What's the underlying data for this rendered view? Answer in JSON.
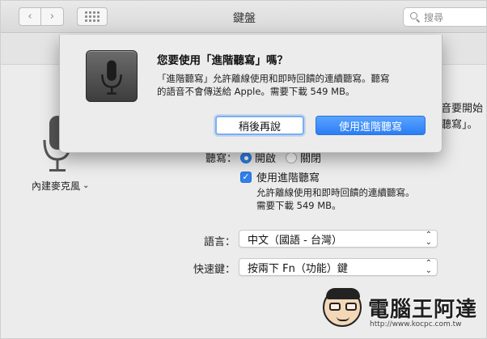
{
  "window": {
    "title": "鍵盤",
    "search_placeholder": "搜尋"
  },
  "toolbar": {
    "back_glyph": "‹",
    "forward_glyph": "›"
  },
  "left_panel": {
    "mic_label": "內建麥克風",
    "chevron": "⌄"
  },
  "behind": {
    "partial_right_1": "音要開始",
    "partial_right_2": "聽寫」。",
    "dictation_label": "聽寫：",
    "radio_on_label": "開啟",
    "radio_off_label": "關閉",
    "enhanced_checkbox_label": "使用進階聽寫",
    "enhanced_desc_line1": "允許離線使用和即時回饋的連續聽寫。",
    "enhanced_desc_line2": "需要下載 549 MB。",
    "language_label": "語言：",
    "language_value": "中文（國語 - 台灣）",
    "shortcut_label": "快速鍵：",
    "shortcut_value": "按兩下 Fn（功能）鍵"
  },
  "dialog": {
    "title": "您要使用「進階聽寫」嗎？",
    "body_line1": "「進階聽寫」允許離線使用和即時回饋的連續聽寫。聽寫",
    "body_line2": "的語音不會傳送給 Apple。需要下載 549 MB。",
    "later_button": "稍後再說",
    "use_button": "使用進階聽寫"
  },
  "watermark": {
    "text": "電腦王阿達",
    "url": "http://www.kocpc.com.tw"
  },
  "colors": {
    "accent": "#2f80ed",
    "window_bg": "#ececec"
  }
}
